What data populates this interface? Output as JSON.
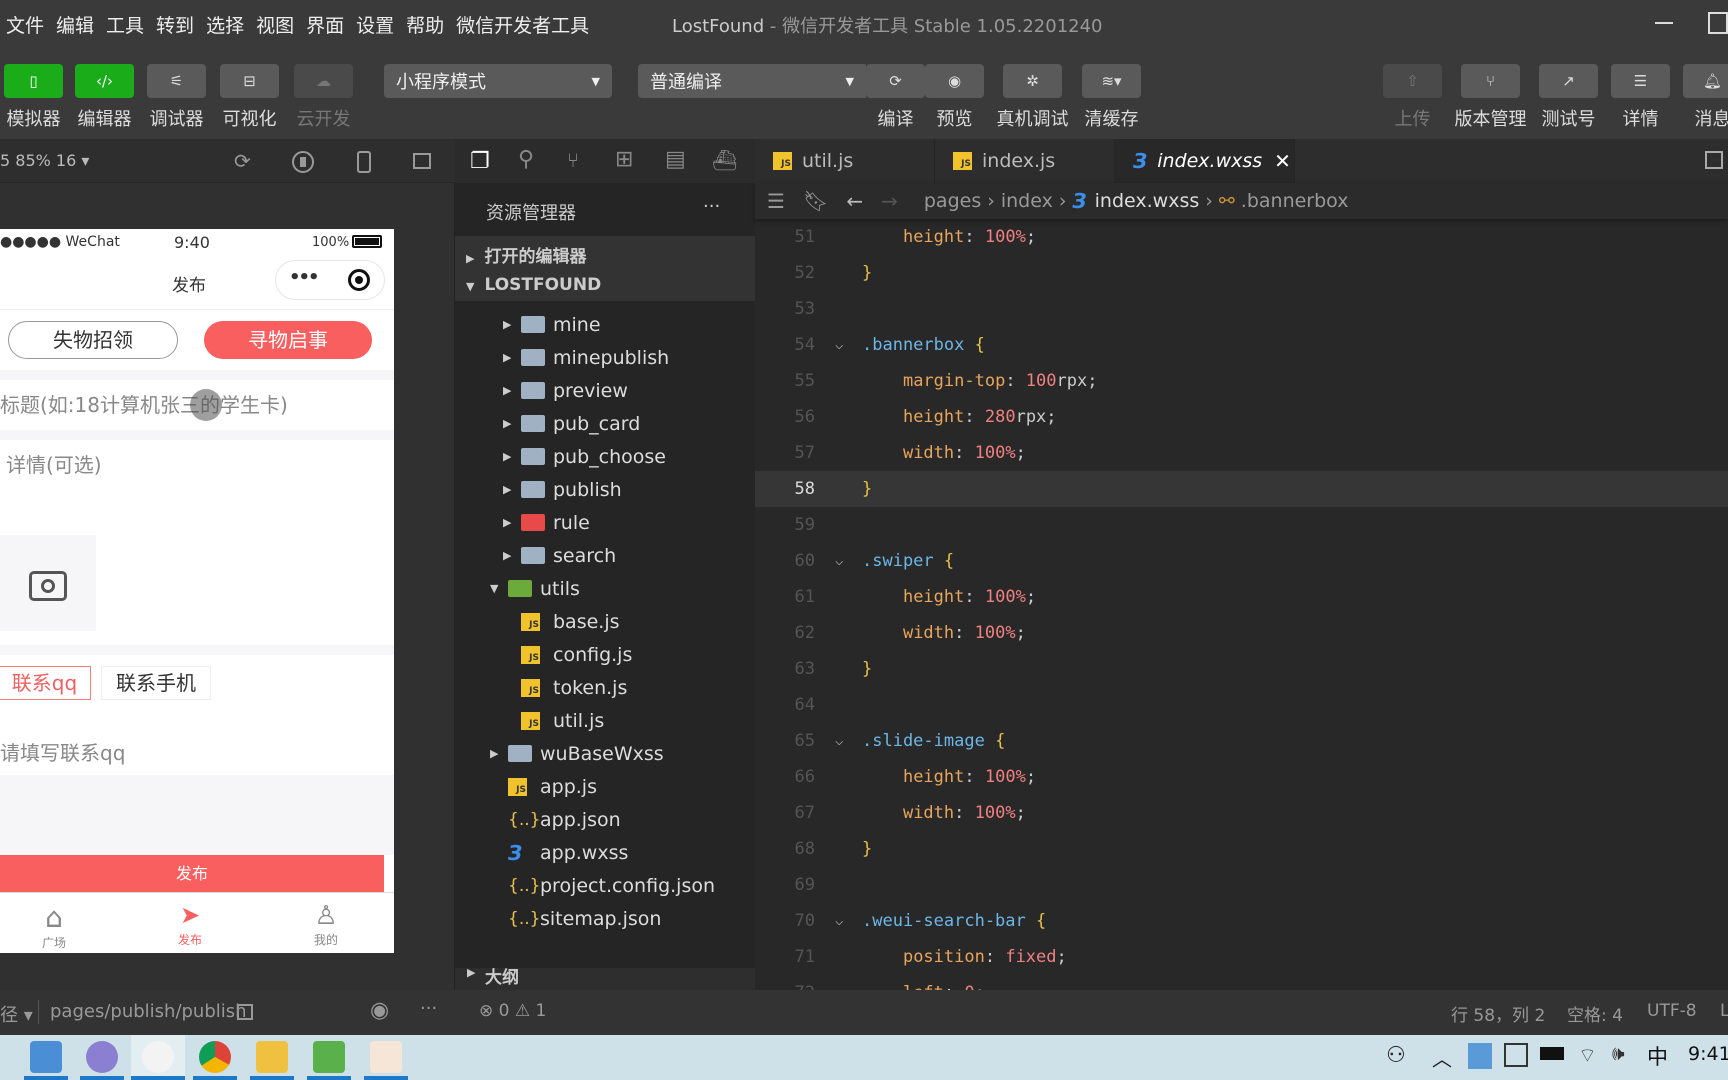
{
  "menu": [
    "文件",
    "编辑",
    "工具",
    "转到",
    "选择",
    "视图",
    "界面",
    "设置",
    "帮助",
    "微信开发者工具"
  ],
  "window": {
    "project": "LostFound",
    "title": " - 微信开发者工具 Stable 1.05.2201240"
  },
  "toolbar": {
    "left": [
      {
        "label": "模拟器",
        "icon": "phone-icon",
        "style": "green"
      },
      {
        "label": "编辑器",
        "icon": "code-icon",
        "style": "green"
      },
      {
        "label": "调试器",
        "icon": "debug-icon",
        "style": "normal"
      },
      {
        "label": "可视化",
        "icon": "layout-icon",
        "style": "normal"
      },
      {
        "label": "云开发",
        "icon": "cloud-icon",
        "style": "dim"
      }
    ],
    "mode_select": "小程序模式",
    "compile_select": "普通编译",
    "mid": [
      {
        "label": "编译",
        "icon": "refresh-icon"
      },
      {
        "label": "预览",
        "icon": "eye-icon"
      },
      {
        "label": "真机调试",
        "icon": "bug-icon"
      },
      {
        "label": "清缓存",
        "icon": "layers-icon"
      }
    ],
    "right": [
      {
        "label": "上传",
        "icon": "upload-icon",
        "dim": true
      },
      {
        "label": "版本管理",
        "icon": "branch-icon"
      },
      {
        "label": "测试号",
        "icon": "external-icon"
      },
      {
        "label": "详情",
        "icon": "menu-icon"
      },
      {
        "label": "消息",
        "icon": "bell-icon"
      }
    ]
  },
  "simulator": {
    "zoom": "5 85% 16 ▾",
    "status": {
      "carrier": "●●●●● WeChat",
      "time": "9:40",
      "battery": "100%"
    },
    "nav_title": "发布",
    "tabs": [
      "失物招领",
      "寻物启事"
    ],
    "title_placeholder": "标题(如:18计算机张三的学生卡)",
    "detail_placeholder": "详情(可选)",
    "contact_tabs": [
      "联系qq",
      "联系手机"
    ],
    "contact_placeholder": "请填写联系qq",
    "publish_button": "发布",
    "tabbar": [
      "广场",
      "发布",
      "我的"
    ],
    "path_label": "径 ▾",
    "path": "pages/publish/publish",
    "accent": "#fa5f5f"
  },
  "explorer": {
    "title": "资源管理器",
    "more": "···",
    "open_editors": "打开的编辑器",
    "project": "LOSTFOUND",
    "outline": "大纲",
    "items": [
      {
        "label": "mine",
        "type": "folder",
        "depth": 1
      },
      {
        "label": "minepublish",
        "type": "folder",
        "depth": 1
      },
      {
        "label": "preview",
        "type": "folder",
        "depth": 1
      },
      {
        "label": "pub_card",
        "type": "folder",
        "depth": 1
      },
      {
        "label": "pub_choose",
        "type": "folder",
        "depth": 1
      },
      {
        "label": "publish",
        "type": "folder",
        "depth": 1
      },
      {
        "label": "rule",
        "type": "folder-red",
        "depth": 1
      },
      {
        "label": "search",
        "type": "folder",
        "depth": 1
      },
      {
        "label": "utils",
        "type": "folder-open",
        "depth": 0
      },
      {
        "label": "base.js",
        "type": "js",
        "depth": 1
      },
      {
        "label": "config.js",
        "type": "js",
        "depth": 1
      },
      {
        "label": "token.js",
        "type": "js",
        "depth": 1
      },
      {
        "label": "util.js",
        "type": "js",
        "depth": 1
      },
      {
        "label": "wuBaseWxss",
        "type": "folder",
        "depth": 0
      },
      {
        "label": "app.js",
        "type": "js",
        "depth": 0
      },
      {
        "label": "app.json",
        "type": "json",
        "depth": 0
      },
      {
        "label": "app.wxss",
        "type": "css",
        "depth": 0
      },
      {
        "label": "project.config.json",
        "type": "json",
        "depth": 0
      },
      {
        "label": "sitemap.json",
        "type": "json",
        "depth": 0
      }
    ]
  },
  "editor": {
    "tabs": [
      {
        "label": "util.js",
        "type": "js"
      },
      {
        "label": "index.js",
        "type": "js"
      },
      {
        "label": "index.wxss",
        "type": "css",
        "active": true
      }
    ],
    "breadcrumb": [
      "pages",
      "index",
      "index.wxss",
      ".bannerbox"
    ],
    "current_line": 58,
    "lines": [
      {
        "n": 51,
        "parts": [
          [
            "    ",
            ""
          ],
          [
            "height",
            "prop"
          ],
          [
            ": ",
            "pun"
          ],
          [
            "100%",
            "num"
          ],
          [
            ";",
            "pun"
          ]
        ]
      },
      {
        "n": 52,
        "parts": [
          [
            "}",
            "brace"
          ]
        ]
      },
      {
        "n": 53,
        "parts": []
      },
      {
        "n": 54,
        "fold": true,
        "parts": [
          [
            ".bannerbox ",
            "sel"
          ],
          [
            "{",
            "brace"
          ]
        ]
      },
      {
        "n": 55,
        "parts": [
          [
            "    ",
            ""
          ],
          [
            "margin-top",
            "prop"
          ],
          [
            ": ",
            "pun"
          ],
          [
            "100",
            "num"
          ],
          [
            "rpx",
            "pun"
          ],
          [
            ";",
            "pun"
          ]
        ]
      },
      {
        "n": 56,
        "parts": [
          [
            "    ",
            ""
          ],
          [
            "height",
            "prop"
          ],
          [
            ": ",
            "pun"
          ],
          [
            "280",
            "num"
          ],
          [
            "rpx",
            "pun"
          ],
          [
            ";",
            "pun"
          ]
        ]
      },
      {
        "n": 57,
        "parts": [
          [
            "    ",
            ""
          ],
          [
            "width",
            "prop"
          ],
          [
            ": ",
            "pun"
          ],
          [
            "100%",
            "num"
          ],
          [
            ";",
            "pun"
          ]
        ]
      },
      {
        "n": 58,
        "parts": [
          [
            "}",
            "brace"
          ]
        ]
      },
      {
        "n": 59,
        "parts": []
      },
      {
        "n": 60,
        "fold": true,
        "parts": [
          [
            ".swiper ",
            "sel"
          ],
          [
            "{",
            "brace"
          ]
        ]
      },
      {
        "n": 61,
        "parts": [
          [
            "    ",
            ""
          ],
          [
            "height",
            "prop"
          ],
          [
            ": ",
            "pun"
          ],
          [
            "100%",
            "num"
          ],
          [
            ";",
            "pun"
          ]
        ]
      },
      {
        "n": 62,
        "parts": [
          [
            "    ",
            ""
          ],
          [
            "width",
            "prop"
          ],
          [
            ": ",
            "pun"
          ],
          [
            "100%",
            "num"
          ],
          [
            ";",
            "pun"
          ]
        ]
      },
      {
        "n": 63,
        "parts": [
          [
            "}",
            "brace"
          ]
        ]
      },
      {
        "n": 64,
        "parts": []
      },
      {
        "n": 65,
        "fold": true,
        "parts": [
          [
            ".slide-image ",
            "sel"
          ],
          [
            "{",
            "brace"
          ]
        ]
      },
      {
        "n": 66,
        "parts": [
          [
            "    ",
            ""
          ],
          [
            "height",
            "prop"
          ],
          [
            ": ",
            "pun"
          ],
          [
            "100%",
            "num"
          ],
          [
            ";",
            "pun"
          ]
        ]
      },
      {
        "n": 67,
        "parts": [
          [
            "    ",
            ""
          ],
          [
            "width",
            "prop"
          ],
          [
            ": ",
            "pun"
          ],
          [
            "100%",
            "num"
          ],
          [
            ";",
            "pun"
          ]
        ]
      },
      {
        "n": 68,
        "parts": [
          [
            "}",
            "brace"
          ]
        ]
      },
      {
        "n": 69,
        "parts": []
      },
      {
        "n": 70,
        "fold": true,
        "parts": [
          [
            ".weui-search-bar ",
            "sel"
          ],
          [
            "{",
            "brace"
          ]
        ]
      },
      {
        "n": 71,
        "parts": [
          [
            "    ",
            ""
          ],
          [
            "position",
            "prop"
          ],
          [
            ": ",
            "pun"
          ],
          [
            "fixed",
            "val"
          ],
          [
            ";",
            "pun"
          ]
        ]
      },
      {
        "n": 72,
        "parts": [
          [
            "    ",
            ""
          ],
          [
            "left",
            "prop"
          ],
          [
            ": ",
            "pun"
          ],
          [
            "0",
            "num"
          ],
          [
            ";",
            "pun"
          ]
        ]
      }
    ]
  },
  "statusbar": {
    "errors": "0",
    "warnings": "1",
    "position": "行 58，列 2",
    "spaces": "空格: 4",
    "encoding": "UTF-8",
    "eol": "L"
  },
  "taskbar": {
    "ime": "中",
    "time": "9:41"
  }
}
